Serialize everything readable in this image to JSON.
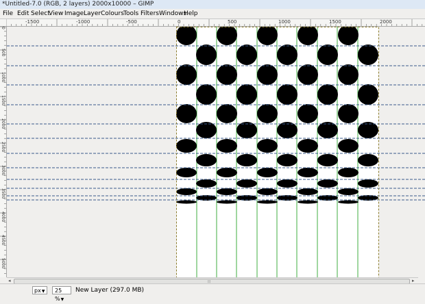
{
  "window": {
    "title": "*Untitled-7.0 (RGB, 2 layers) 2000x10000 – GIMP"
  },
  "menu": [
    "File",
    "Edit",
    "Select",
    "View",
    "Image",
    "Layer",
    "Colours",
    "Tools",
    "Filters",
    "Windows",
    "Help"
  ],
  "ruler": {
    "h_labels": [
      "-1500",
      "-1000",
      "-500",
      "0",
      "500",
      "1000",
      "1500",
      "2000"
    ],
    "v_labels": [
      "0",
      "500",
      "1000",
      "1500",
      "2000",
      "2500",
      "3000",
      "3500",
      "4000",
      "4500",
      "5000"
    ]
  },
  "status": {
    "unit": "px",
    "zoom": "25 %",
    "message": "New Layer (297.0 MB)"
  },
  "colors": {
    "dot": "#000000",
    "guide_blue": "#3a5a8a",
    "guide_green": "#3fae3f",
    "border": "#8a7a2a",
    "canvas": "#ffffff",
    "workspace": "#f0efed"
  }
}
